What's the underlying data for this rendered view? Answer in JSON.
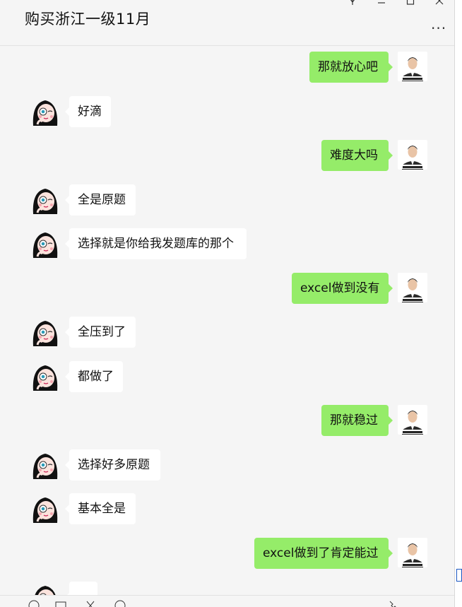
{
  "header": {
    "title": "购买浙江一级11月",
    "more_label": "..."
  },
  "window_controls": {
    "pin_icon": "pin-icon",
    "minimize_icon": "minimize-icon",
    "maximize_icon": "maximize-icon",
    "close_icon": "close-icon"
  },
  "avatars": {
    "self": "man-in-suit-avatar",
    "other": "cartoon-girl-avatar"
  },
  "messages": [
    {
      "side": "right",
      "text": "那就放心吧"
    },
    {
      "side": "left",
      "text": "好滴"
    },
    {
      "side": "right",
      "text": "难度大吗"
    },
    {
      "side": "left",
      "text": "全是原题"
    },
    {
      "side": "left",
      "text": "选择就是你给我发题库的那个"
    },
    {
      "side": "right",
      "text": "excel做到没有"
    },
    {
      "side": "left",
      "text": "全压到了"
    },
    {
      "side": "left",
      "text": "都做了"
    },
    {
      "side": "right",
      "text": "那就稳过"
    },
    {
      "side": "left",
      "text": "选择好多原题"
    },
    {
      "side": "left",
      "text": "基本全是"
    },
    {
      "side": "right",
      "text": "excel做到了肯定能过"
    },
    {
      "side": "left",
      "text": ""
    }
  ],
  "colors": {
    "self_bubble": "#95ec69",
    "other_bubble": "#ffffff",
    "background": "#f5f5f5"
  }
}
